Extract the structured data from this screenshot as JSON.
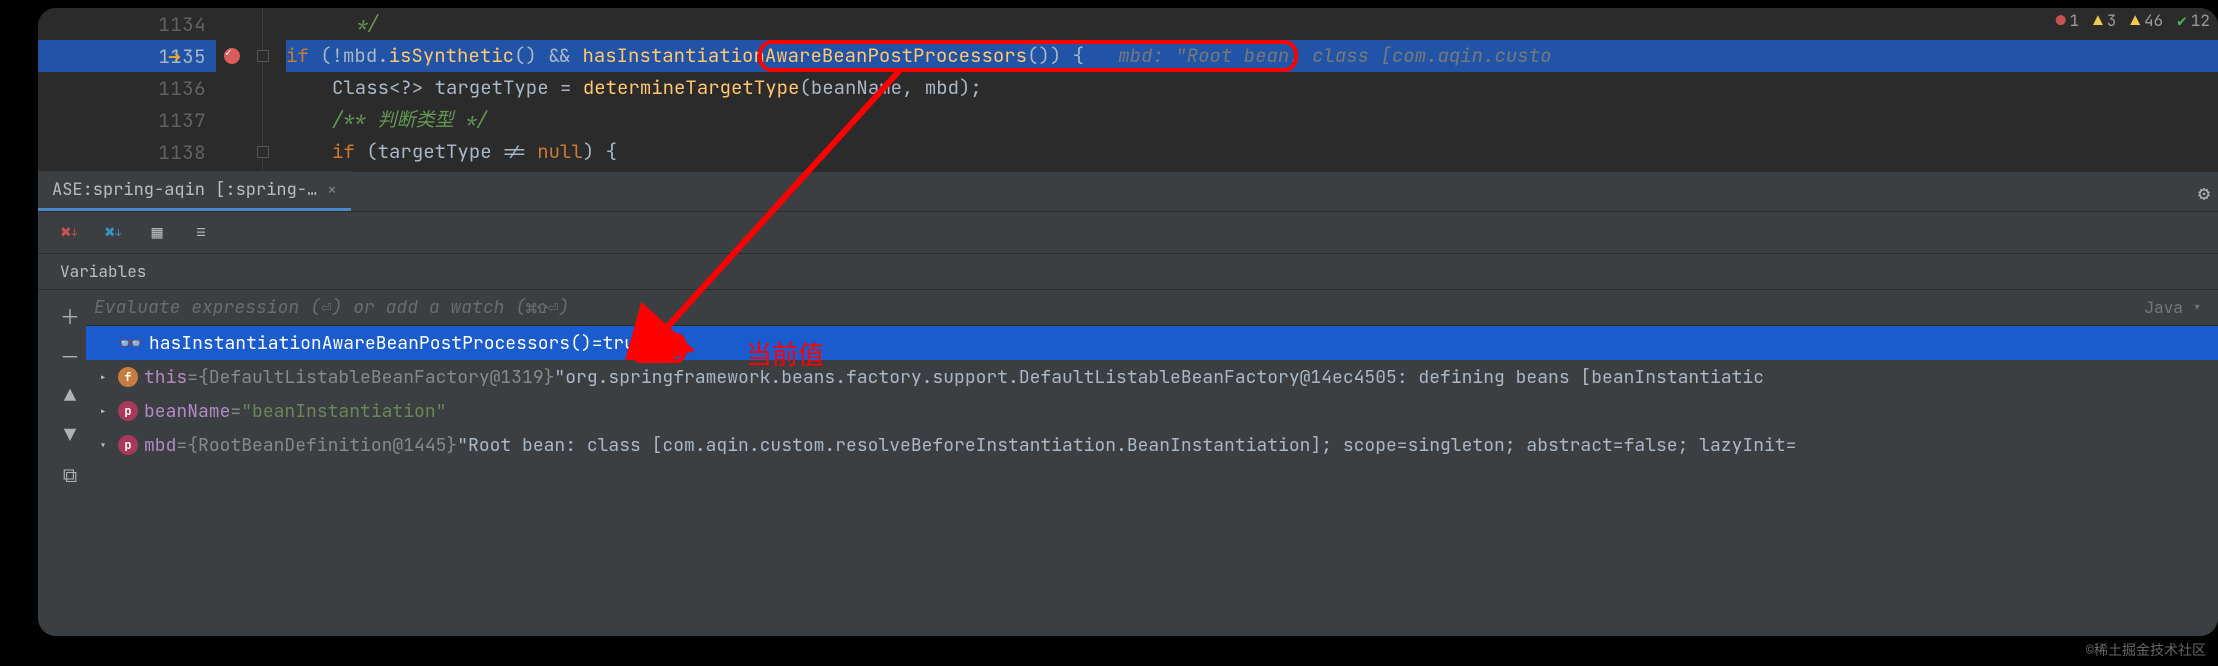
{
  "status_bar": {
    "err": "1",
    "warn1": "3",
    "warn2": "46",
    "info": "12"
  },
  "gutter": {
    "l0": "1134",
    "l1": "1135",
    "l2": "1136",
    "l3": "1137",
    "l4": "1138"
  },
  "code": {
    "l0_cmt": "*/",
    "l1_if": "if",
    "l1_a": " (!mbd.",
    "l1_m1": "isSynthetic",
    "l1_b": "() && ",
    "l1_m2": "hasInstantiationAwareBeanPostProcessors",
    "l1_c": "()",
    "l1_d": ") {",
    "l1_inlay": "   mbd: \"Root bean: class [com.aqin.custo",
    "l2_a": "Class<?> targetType = ",
    "l2_m": "determineTargetType",
    "l2_b": "(beanName, mbd);",
    "l3_cmt": "/** 判断类型 */",
    "l4_if": "if",
    "l4_a": " (targetType != ",
    "l4_null": "null",
    "l4_b": ") {"
  },
  "tab": {
    "label": "ASE:spring-aqin [:spring-…"
  },
  "vars_header": "Variables",
  "watch_placeholder": "Evaluate expression (⏎) or add a watch (⌘⇧⏎)",
  "lang": "Java",
  "rows": {
    "r0_name": "hasInstantiationAwareBeanPostProcessors()",
    "r0_eq": " = ",
    "r0_val": "true",
    "r1_name": "this",
    "r1_eq": " = ",
    "r1_type": "{DefaultListableBeanFactory@1319}",
    "r1_val": " \"org.springframework.beans.factory.support.DefaultListableBeanFactory@14ec4505: defining beans [beanInstantiatic",
    "r2_name": "beanName",
    "r2_eq": " = ",
    "r2_val": "\"beanInstantiation\"",
    "r3_name": "mbd",
    "r3_eq": " = ",
    "r3_type": "{RootBeanDefinition@1445}",
    "r3_val": " \"Root bean: class [com.aqin.custom.resolveBeforeInstantiation.BeanInstantiation]; scope=singleton; abstract=false; lazyInit="
  },
  "annotation": "当前值",
  "watermark": "©稀土掘金技术社区"
}
